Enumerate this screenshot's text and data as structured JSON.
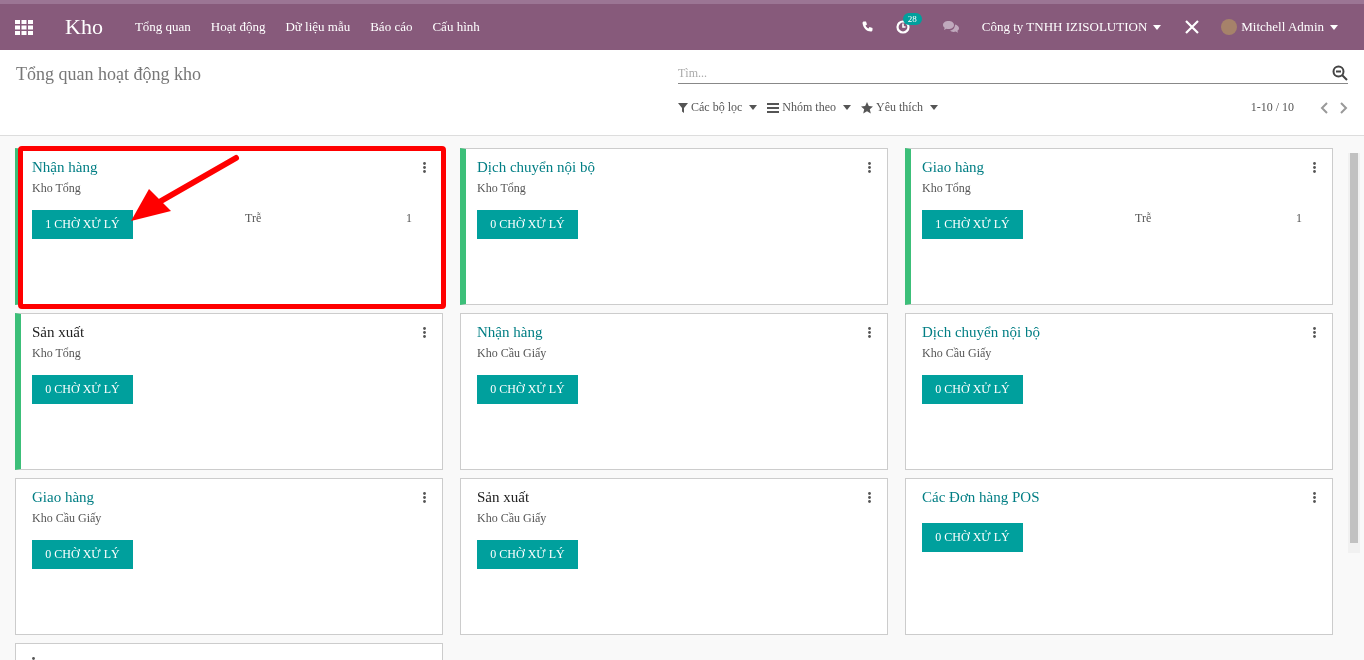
{
  "navbar": {
    "app_name": "Kho",
    "menu": [
      "Tổng quan",
      "Hoạt động",
      "Dữ liệu mẫu",
      "Báo cáo",
      "Cấu hình"
    ],
    "activity_count": "28",
    "company": "Công ty TNHH IZISOLUTION",
    "user": "Mitchell Admin"
  },
  "control_panel": {
    "title": "Tổng quan hoạt động kho",
    "search": {
      "placeholder": "Tìm..."
    },
    "filters": [
      "Các bộ lọc",
      "Nhóm theo",
      "Yêu thích"
    ],
    "pager": "1-10 / 10"
  },
  "cards": [
    {
      "title": "Nhận hàng",
      "kind": "link",
      "warehouse": "Kho Tổng",
      "button": "1 CHỜ XỬ LÝ",
      "late_label": "Trễ",
      "late_count": "1",
      "accent": true,
      "highlighted": true
    },
    {
      "title": "Dịch chuyển nội bộ",
      "kind": "link",
      "warehouse": "Kho Tổng",
      "button": "0 CHỜ XỬ LÝ",
      "accent": true,
      "highlighted": false
    },
    {
      "title": "Giao hàng",
      "kind": "link",
      "warehouse": "Kho Tổng",
      "button": "1 CHỜ XỬ LÝ",
      "late_label": "Trễ",
      "late_count": "1",
      "accent": true,
      "highlighted": false
    },
    {
      "title": "Sản xuất",
      "kind": "plain",
      "warehouse": "Kho Tổng",
      "button": "0 CHỜ XỬ LÝ",
      "accent": true,
      "highlighted": false
    },
    {
      "title": "Nhận hàng",
      "kind": "link",
      "warehouse": "Kho Cầu Giấy",
      "button": "0 CHỜ XỬ LÝ",
      "accent": false,
      "highlighted": false
    },
    {
      "title": "Dịch chuyển nội bộ",
      "kind": "link",
      "warehouse": "Kho Cầu Giấy",
      "button": "0 CHỜ XỬ LÝ",
      "accent": false,
      "highlighted": false
    },
    {
      "title": "Giao hàng",
      "kind": "link",
      "warehouse": "Kho Cầu Giấy",
      "button": "0 CHỜ XỬ LÝ",
      "accent": false,
      "highlighted": false
    },
    {
      "title": "Sản xuất",
      "kind": "plain",
      "warehouse": "Kho Cầu Giấy",
      "button": "0 CHỜ XỬ LÝ",
      "accent": false,
      "highlighted": false
    },
    {
      "title": "Các Đơn hàng POS",
      "kind": "link",
      "button": "0 CHỜ XỬ LÝ",
      "accent": false,
      "highlighted": false
    },
    {
      "accent": false
    }
  ]
}
